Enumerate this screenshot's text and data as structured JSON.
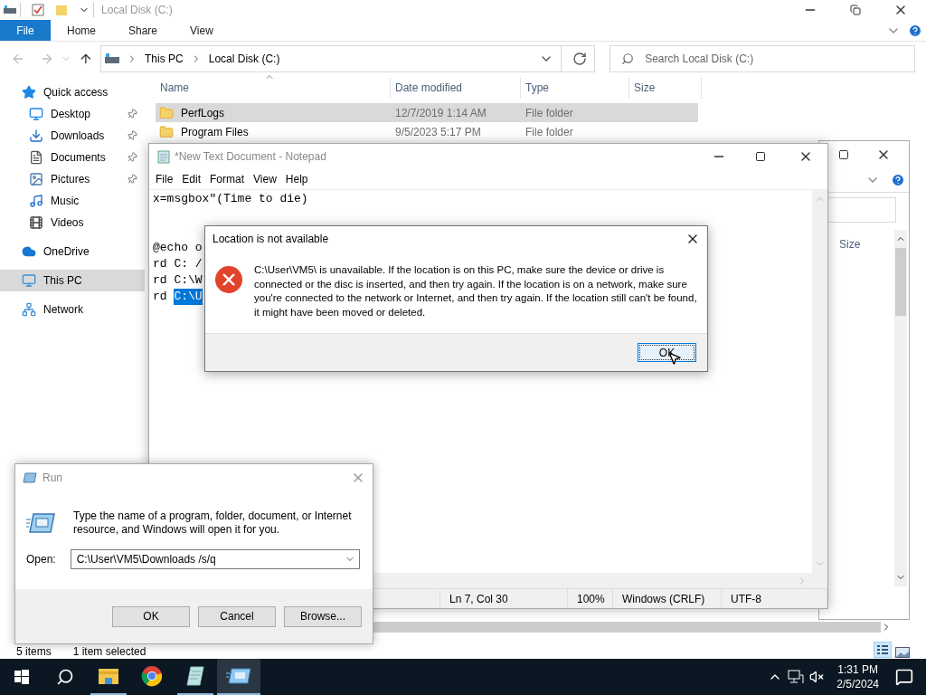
{
  "explorer": {
    "title": "Local Disk (C:)",
    "tabs": [
      {
        "label": "File",
        "selected": true
      },
      {
        "label": "Home",
        "selected": false
      },
      {
        "label": "Share",
        "selected": false
      },
      {
        "label": "View",
        "selected": false
      }
    ],
    "address": [
      "This PC",
      "Local Disk (C:)"
    ],
    "search": {
      "placeholder": "Search Local Disk (C:)"
    },
    "nav": [
      {
        "label": "Quick access",
        "pinned": false,
        "selected": false,
        "children": [
          {
            "label": "Desktop",
            "pinned": true,
            "selected": false
          },
          {
            "label": "Downloads",
            "pinned": true,
            "selected": false
          },
          {
            "label": "Documents",
            "pinned": true,
            "selected": false
          },
          {
            "label": "Pictures",
            "pinned": true,
            "selected": false
          },
          {
            "label": "Music",
            "pinned": false,
            "selected": false
          },
          {
            "label": "Videos",
            "pinned": false,
            "selected": false
          }
        ]
      },
      {
        "label": "OneDrive",
        "pinned": false,
        "selected": false
      },
      {
        "label": "This PC",
        "pinned": false,
        "selected": true
      },
      {
        "label": "Network",
        "pinned": false,
        "selected": false
      }
    ],
    "columns": [
      "Name",
      "Date modified",
      "Type",
      "Size"
    ],
    "rows": [
      {
        "name": "PerfLogs",
        "date": "12/7/2019 1:14 AM",
        "type": "File folder",
        "selected": true
      },
      {
        "name": "Program Files",
        "date": "9/5/2023 5:17 PM",
        "type": "File folder",
        "selected": false
      }
    ],
    "status": [
      "5 items",
      "1 item selected"
    ]
  },
  "second_window": {
    "column": "Size"
  },
  "notepad": {
    "title": "*New Text Document - Notepad",
    "menu": [
      "File",
      "Edit",
      "Format",
      "View",
      "Help"
    ],
    "lines": [
      {
        "kind": "text",
        "text": "x=msgbox\"(Time to die)"
      },
      {
        "kind": "blank"
      },
      {
        "kind": "blank"
      },
      {
        "kind": "text",
        "text": "@echo o"
      },
      {
        "kind": "text",
        "text": "rd C: /"
      },
      {
        "kind": "text",
        "text": "rd C:\\W"
      },
      {
        "kind": "text",
        "text": "rd ",
        "selected_text": "C:\\U"
      }
    ],
    "status": [
      "Ln 7, Col 30",
      "100%",
      "Windows (CRLF)",
      "UTF-8"
    ]
  },
  "error_dialog": {
    "title": "Location is not available",
    "message": "C:\\User\\VM5\\ is unavailable. If the location is on this PC, make sure the device or drive is connected or the disc is inserted, and then try again. If the location is on a network, make sure you're connected to the network or Internet, and then try again. If the location still can't be found, it might have been moved or deleted.",
    "button": {
      "label": "OK",
      "focused": true
    }
  },
  "run_dialog": {
    "title": "Run",
    "description": "Type the name of a program, folder, document, or Internet resource, and Windows will open it for you.",
    "open_label": "Open:",
    "value": "C:\\User\\VM5\\Downloads /s/q",
    "buttons": [
      {
        "label": "OK"
      },
      {
        "label": "Cancel"
      },
      {
        "label": "Browse..."
      }
    ]
  },
  "taskbar": {
    "apps": [
      {
        "running": true,
        "active": false
      },
      {
        "running": false,
        "active": false
      },
      {
        "running": true,
        "active": false
      },
      {
        "running": true,
        "active": true
      }
    ],
    "time": "1:31 PM",
    "date": "2/5/2024"
  }
}
